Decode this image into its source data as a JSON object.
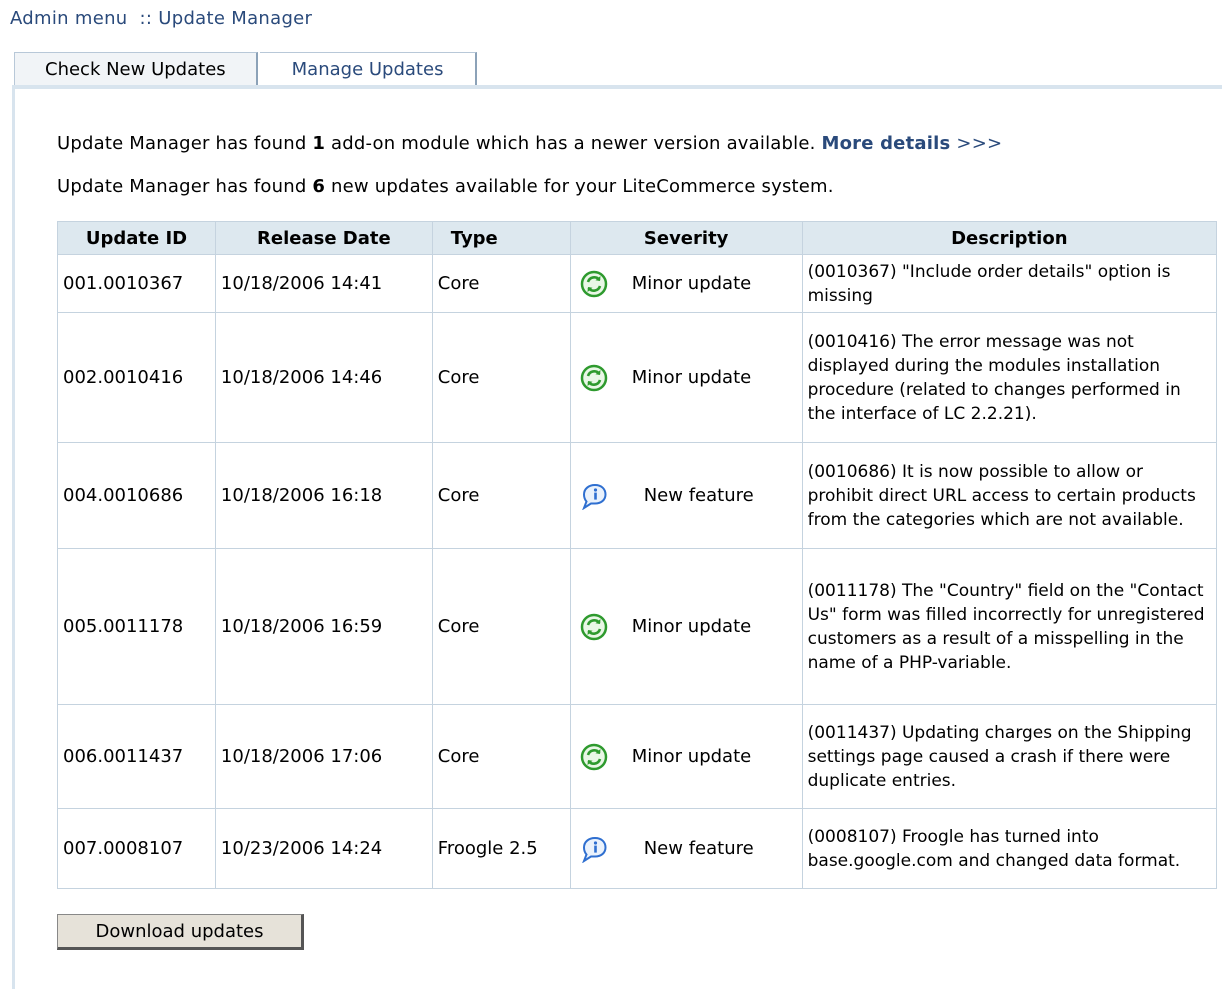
{
  "breadcrumb": {
    "admin": "Admin menu",
    "separator": "::",
    "current": "Update Manager"
  },
  "tabs": [
    {
      "label": "Check New Updates"
    },
    {
      "label": "Manage Updates"
    }
  ],
  "messages": {
    "line1_pre": "Update Manager has found ",
    "line1_count": "1",
    "line1_post": " add-on module which has a newer version available. ",
    "more_label": "More details",
    "more_arrows": ">>>",
    "line2_pre": "Update Manager has found ",
    "line2_count": "6",
    "line2_post": " new updates available for your LiteCommerce system."
  },
  "table": {
    "headers": [
      "Update ID",
      "Release Date",
      "Type",
      "Severity",
      "Description"
    ],
    "rows": [
      {
        "id": "001.0010367",
        "date": "10/18/2006 14:41",
        "type": "Core",
        "severity": "Minor update",
        "icon": "refresh-icon",
        "desc": "(0010367) \"Include order details\" option is missing"
      },
      {
        "id": "002.0010416",
        "date": "10/18/2006 14:46",
        "type": "Core",
        "severity": "Minor update",
        "icon": "refresh-icon",
        "desc": "(0010416) The error message was not displayed during the modules installation procedure (related to changes performed in the interface of LC 2.2.21)."
      },
      {
        "id": "004.0010686",
        "date": "10/18/2006 16:18",
        "type": "Core",
        "severity": "New feature",
        "icon": "info-bubble-icon",
        "desc": "(0010686) It is now possible to allow or prohibit direct URL access to certain products from the categories which are not available."
      },
      {
        "id": "005.0011178",
        "date": "10/18/2006 16:59",
        "type": "Core",
        "severity": "Minor update",
        "icon": "refresh-icon",
        "desc": "(0011178) The \"Country\" field on the \"Contact Us\" form was filled incorrectly for unregistered customers as a result of a misspelling in the name of a PHP-variable."
      },
      {
        "id": "006.0011437",
        "date": "10/18/2006 17:06",
        "type": "Core",
        "severity": "Minor update",
        "icon": "refresh-icon",
        "desc": "(0011437) Updating charges on the Shipping settings page caused a crash if there were duplicate entries."
      },
      {
        "id": "007.0008107",
        "date": "10/23/2006 14:24",
        "type": "Froogle 2.5",
        "severity": "New feature",
        "icon": "info-bubble-icon",
        "desc": "(0008107) Froogle has turned into base.google.com and changed data format."
      }
    ]
  },
  "download_button": "Download updates",
  "colors": {
    "link": "#2a4a7b",
    "header_bg": "#dde8ef",
    "border": "#c5d3df",
    "refresh_green": "#2e9a2e",
    "info_blue": "#2f6fd0"
  }
}
